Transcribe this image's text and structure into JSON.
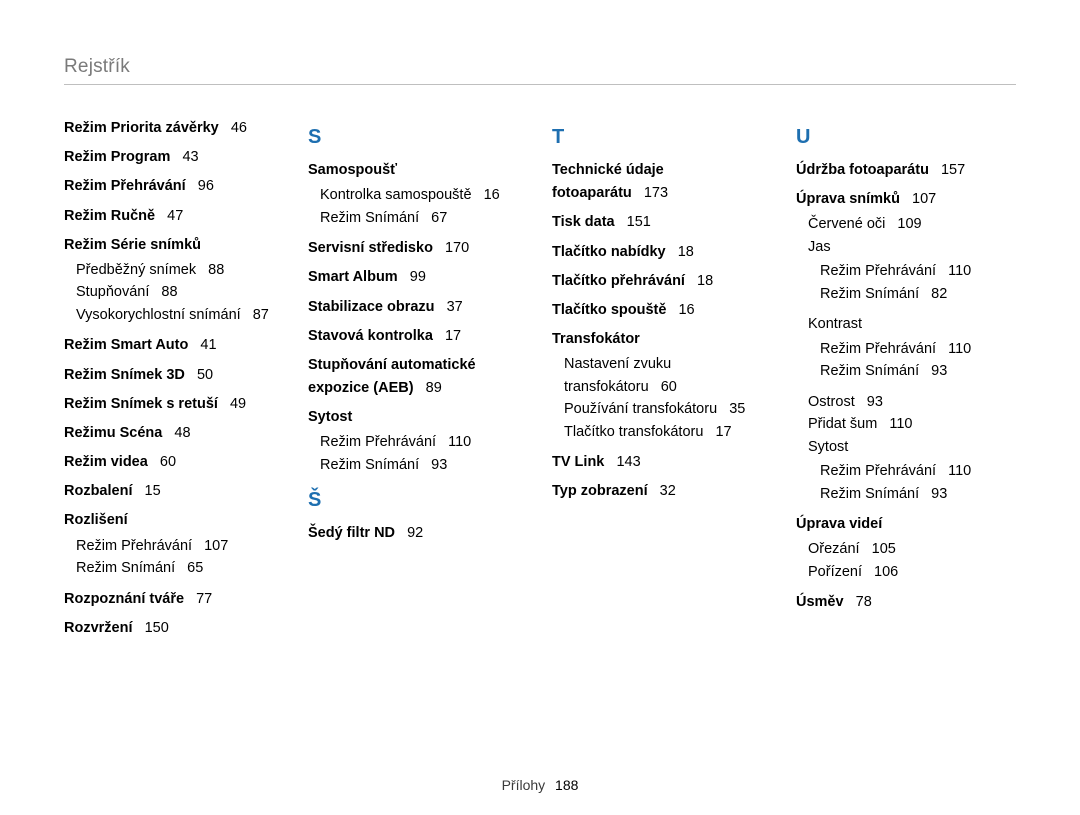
{
  "title": "Rejstřík",
  "footer": {
    "label": "Přílohy",
    "page": "188"
  },
  "cols": [
    {
      "letters": [],
      "preItems": [
        {
          "label": "Režim Priorita závěrky",
          "page": "46"
        },
        {
          "label": "Režim Program",
          "page": "43"
        },
        {
          "label": "Režim Přehrávání",
          "page": "96"
        },
        {
          "label": "Režim Ručně",
          "page": "47"
        },
        {
          "label": "Režim Série snímků",
          "page": "",
          "subs": [
            {
              "label": "Předběžný snímek",
              "page": "88"
            },
            {
              "label": "Stupňování",
              "page": "88"
            },
            {
              "label": "Vysokorychlostní snímání",
              "page": "87"
            }
          ]
        },
        {
          "label": "Režim Smart Auto",
          "page": "41"
        },
        {
          "label": "Režim Snímek 3D",
          "page": "50"
        },
        {
          "label": "Režim Snímek s retuší",
          "page": "49"
        },
        {
          "label": "Režimu Scéna",
          "page": "48"
        },
        {
          "label": "Režim videa",
          "page": "60"
        },
        {
          "label": "Rozbalení",
          "page": "15"
        },
        {
          "label": "Rozlišení",
          "page": "",
          "subs": [
            {
              "label": "Režim Přehrávání",
              "page": "107"
            },
            {
              "label": "Režim Snímání",
              "page": "65"
            }
          ]
        },
        {
          "label": "Rozpoznání tváře",
          "page": "77"
        },
        {
          "label": "Rozvržení",
          "page": "150"
        }
      ],
      "sections": []
    },
    {
      "letters": [
        "S",
        "Š"
      ],
      "sections": [
        {
          "letter": "S",
          "items": [
            {
              "label": "Samospoušť",
              "page": "",
              "subs": [
                {
                  "label": "Kontrolka samospouště",
                  "page": "16"
                },
                {
                  "label": "Režim Snímání",
                  "page": "67"
                }
              ]
            },
            {
              "label": "Servisní středisko",
              "page": "170"
            },
            {
              "label": "Smart Album",
              "page": "99"
            },
            {
              "label": "Stabilizace obrazu",
              "page": "37"
            },
            {
              "label": "Stavová kontrolka",
              "page": "17"
            },
            {
              "label": "Stupňování automatické expozice (AEB)",
              "page": "89"
            },
            {
              "label": "Sytost",
              "page": "",
              "subs": [
                {
                  "label": "Režim Přehrávání",
                  "page": "110"
                },
                {
                  "label": "Režim Snímání",
                  "page": "93"
                }
              ]
            }
          ]
        },
        {
          "letter": "Š",
          "items": [
            {
              "label": "Šedý filtr ND",
              "page": "92"
            }
          ]
        }
      ]
    },
    {
      "letters": [
        "T"
      ],
      "sections": [
        {
          "letter": "T",
          "items": [
            {
              "label": "Technické údaje fotoaparátu",
              "page": "173"
            },
            {
              "label": "Tisk data",
              "page": "151"
            },
            {
              "label": "Tlačítko nabídky",
              "page": "18"
            },
            {
              "label": "Tlačítko přehrávání",
              "page": "18"
            },
            {
              "label": "Tlačítko spouště",
              "page": "16"
            },
            {
              "label": "Transfokátor",
              "page": "",
              "subs": [
                {
                  "label": "Nastavení zvuku transfokátoru",
                  "page": "60"
                },
                {
                  "label": "Používání transfokátoru",
                  "page": "35"
                },
                {
                  "label": "Tlačítko transfokátoru",
                  "page": "17"
                }
              ]
            },
            {
              "label": "TV Link",
              "page": "143"
            },
            {
              "label": "Typ zobrazení",
              "page": "32"
            }
          ]
        }
      ]
    },
    {
      "letters": [
        "U"
      ],
      "sections": [
        {
          "letter": "U",
          "items": [
            {
              "label": "Údržba fotoaparátu",
              "page": "157"
            },
            {
              "label": "Úprava snímků",
              "page": "107",
              "subs": [
                {
                  "label": "Červené oči",
                  "page": "109"
                },
                {
                  "label": "Jas",
                  "page": "",
                  "subs2": [
                    {
                      "label": "Režim Přehrávání",
                      "page": "110"
                    },
                    {
                      "label": "Režim Snímání",
                      "page": "82"
                    }
                  ]
                },
                {
                  "label": "Kontrast",
                  "page": "",
                  "subs2": [
                    {
                      "label": "Režim Přehrávání",
                      "page": "110"
                    },
                    {
                      "label": "Režim Snímání",
                      "page": "93"
                    }
                  ]
                },
                {
                  "label": "Ostrost",
                  "page": "93"
                },
                {
                  "label": "Přidat šum",
                  "page": "110"
                },
                {
                  "label": "Sytost",
                  "page": "",
                  "subs2": [
                    {
                      "label": "Režim Přehrávání",
                      "page": "110"
                    },
                    {
                      "label": "Režim Snímání",
                      "page": "93"
                    }
                  ]
                }
              ]
            },
            {
              "label": "Úprava videí",
              "page": "",
              "subs": [
                {
                  "label": "Ořezání",
                  "page": "105"
                },
                {
                  "label": "Pořízení",
                  "page": "106"
                }
              ]
            },
            {
              "label": "Úsměv",
              "page": "78"
            }
          ]
        }
      ]
    }
  ]
}
